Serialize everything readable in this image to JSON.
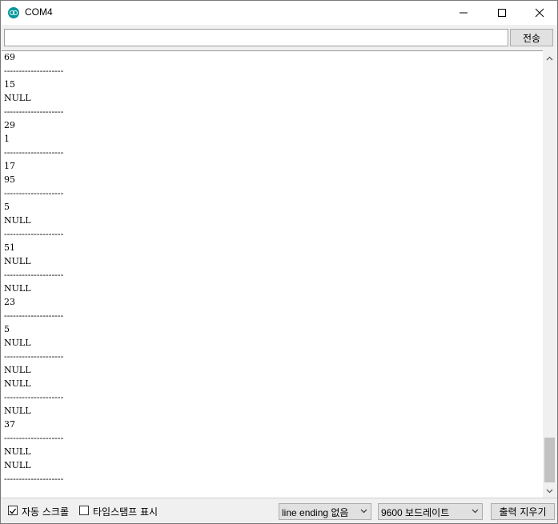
{
  "window": {
    "title": "COM4"
  },
  "send": {
    "input_value": "",
    "button_label": "전송"
  },
  "log": [
    "69",
    "--------------------",
    "15",
    "NULL",
    "--------------------",
    "29",
    "1",
    "--------------------",
    "17",
    "95",
    "--------------------",
    "5",
    "NULL",
    "--------------------",
    "51",
    "NULL",
    "--------------------",
    "NULL",
    "23",
    "--------------------",
    "5",
    "NULL",
    "--------------------",
    "NULL",
    "NULL",
    "--------------------",
    "NULL",
    "37",
    "--------------------",
    "NULL",
    "NULL",
    "--------------------"
  ],
  "statusbar": {
    "autoscroll_label": "자동 스크롤",
    "autoscroll_checked": true,
    "timestamp_label": "타임스탬프 표시",
    "timestamp_checked": false,
    "line_ending": "line ending 없음",
    "baud_rate": "9600 보드레이트",
    "clear_label": "출력 지우기"
  }
}
